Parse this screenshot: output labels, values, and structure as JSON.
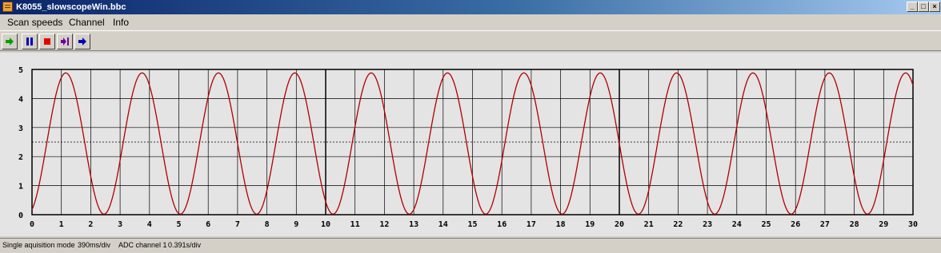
{
  "window": {
    "title": "K8055_slowscopeWin.bbc"
  },
  "menu": {
    "items": [
      "Scan speeds",
      "Channel",
      "Info"
    ]
  },
  "toolbar": {
    "buttons": [
      {
        "name": "start",
        "icon": "green-arrow-icon",
        "color": "#00a000"
      },
      {
        "name": "pause",
        "icon": "pause-icon",
        "color": "#0000c0"
      },
      {
        "name": "stop",
        "icon": "stop-icon",
        "color": "#e00000"
      },
      {
        "name": "step",
        "icon": "step-forward-icon",
        "color": "#7000a0"
      },
      {
        "name": "next",
        "icon": "blue-arrow-icon",
        "color": "#0000c0"
      }
    ]
  },
  "status": {
    "mode": "Single aquisition mode",
    "speed": "390ms/div",
    "channel": "ADC channel 1",
    "timebase": "0.391s/div"
  },
  "chart_data": {
    "type": "line",
    "x_ticks": [
      "0",
      "1",
      "2",
      "3",
      "4",
      "5",
      "6",
      "7",
      "8",
      "9",
      "10",
      "11",
      "12",
      "13",
      "14",
      "15",
      "16",
      "17",
      "18",
      "19",
      "20",
      "21",
      "22",
      "23",
      "24",
      "25",
      "26",
      "27",
      "28",
      "29",
      "30"
    ],
    "y_ticks": [
      "0",
      "1",
      "2",
      "3",
      "4",
      "5"
    ],
    "xlim": [
      0,
      30
    ],
    "ylim": [
      0,
      5
    ],
    "grid": true,
    "trace_color": "#b00000",
    "reference_level": 2.5,
    "series": [
      {
        "waveform": "sine",
        "offset": 2.45,
        "amplitude": 2.43,
        "period": 2.6,
        "first_peak_x": 1.15
      }
    ]
  }
}
